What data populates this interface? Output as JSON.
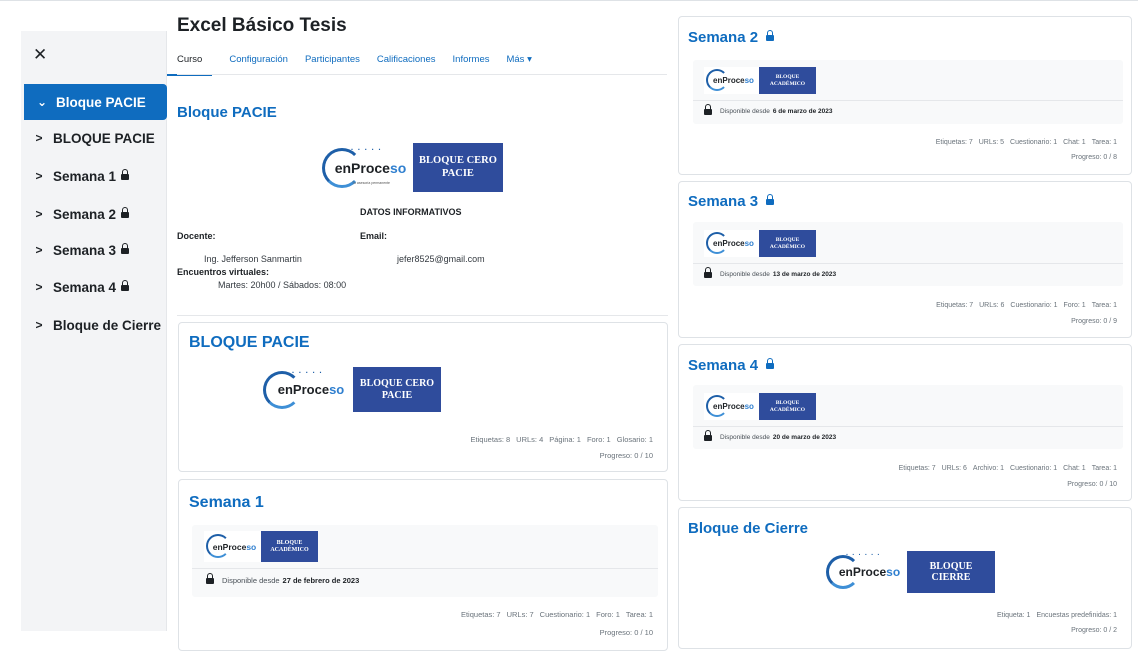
{
  "sidebar": {
    "close_icon": "close-icon",
    "items": [
      {
        "label": "Bloque PACIE",
        "locked": false,
        "active": true
      },
      {
        "label": "BLOQUE PACIE",
        "locked": false,
        "active": false
      },
      {
        "label": "Semana 1",
        "locked": true,
        "active": false
      },
      {
        "label": "Semana 2",
        "locked": true,
        "active": false
      },
      {
        "label": "Semana 3",
        "locked": true,
        "active": false
      },
      {
        "label": "Semana 4",
        "locked": true,
        "active": false
      },
      {
        "label": "Bloque de Cierre",
        "locked": false,
        "active": false
      }
    ]
  },
  "header": {
    "course_title": "Excel Básico Tesis",
    "tabs": [
      "Curso",
      "Configuración",
      "Participantes",
      "Calificaciones",
      "Informes",
      "Más ▾"
    ]
  },
  "logo": {
    "word_a": "enProce",
    "word_b": "so",
    "tagline": "Tu asesoría permanente"
  },
  "bloque_pacie_top": {
    "title": "Bloque PACIE",
    "banner": [
      "BLOQUE CERO",
      "PACIE"
    ],
    "info_title": "DATOS INFORMATIVOS",
    "docente_label": "Docente:",
    "docente_value": "Ing. Jefferson Sanmartin",
    "email_label": "Email:",
    "email_value": "jefer8525@gmail.com",
    "encuentros_label": "Encuentros virtuales:",
    "encuentros_value": "Martes: 20h00  / Sábados: 08:00"
  },
  "bloque_pacie_card": {
    "title": "BLOQUE PACIE",
    "banner": [
      "BLOQUE CERO",
      "PACIE"
    ],
    "counts": [
      "Etiquetas: 8",
      "URLs: 4",
      "Página: 1",
      "Foro: 1",
      "Glosario: 1"
    ],
    "progress": "Progreso: 0 / 10"
  },
  "semana1": {
    "title": "Semana 1",
    "banner": [
      "BLOQUE",
      "ACADÉMICO"
    ],
    "avail_prefix": "Disponible desde",
    "avail_date": "27 de febrero de 2023",
    "counts": [
      "Etiquetas: 7",
      "URLs: 7",
      "Cuestionario: 1",
      "Foro: 1",
      "Tarea: 1"
    ],
    "progress": "Progreso: 0 / 10"
  },
  "semana2": {
    "title": "Semana 2",
    "banner": [
      "BLOQUE",
      "ACADÉMICO"
    ],
    "avail_prefix": "Disponible desde",
    "avail_date": "6 de marzo de 2023",
    "counts": [
      "Etiquetas: 7",
      "URLs: 5",
      "Cuestionario: 1",
      "Chat: 1",
      "Tarea: 1"
    ],
    "progress": "Progreso: 0 / 8"
  },
  "semana3": {
    "title": "Semana 3",
    "banner": [
      "BLOQUE",
      "ACADÉMICO"
    ],
    "avail_prefix": "Disponible desde",
    "avail_date": "13 de marzo de 2023",
    "counts": [
      "Etiquetas: 7",
      "URLs: 6",
      "Cuestionario: 1",
      "Foro: 1",
      "Tarea: 1"
    ],
    "progress": "Progreso: 0 / 9"
  },
  "semana4": {
    "title": "Semana 4",
    "banner": [
      "BLOQUE",
      "ACADÉMICO"
    ],
    "avail_prefix": "Disponible desde",
    "avail_date": "20 de marzo de 2023",
    "counts": [
      "Etiquetas: 7",
      "URLs: 6",
      "Archivo: 1",
      "Cuestionario: 1",
      "Chat: 1",
      "Tarea: 1"
    ],
    "progress": "Progreso: 0 / 10"
  },
  "cierre": {
    "title": "Bloque de Cierre",
    "banner": [
      "BLOQUE",
      "CIERRE"
    ],
    "counts": [
      "Etiqueta: 1",
      "Encuestas predefinidas: 1"
    ],
    "progress": "Progreso: 0 / 2"
  },
  "colors": {
    "accent": "#0f6cbf",
    "banner_blue": "#2f4c9c",
    "sidebar_bg": "#f3f4f6"
  }
}
